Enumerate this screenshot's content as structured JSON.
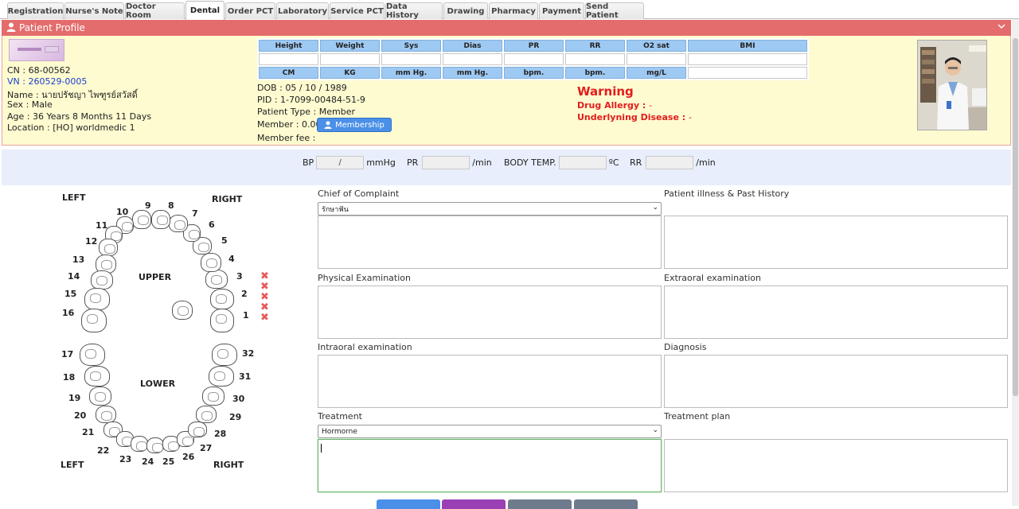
{
  "tabs": [
    {
      "label": "Registration",
      "active": false
    },
    {
      "label": "Nurse's Note",
      "active": false
    },
    {
      "label": "Doctor Room",
      "active": false
    },
    {
      "label": "Dental",
      "active": true
    },
    {
      "label": "Order PCT",
      "active": false
    },
    {
      "label": "Laboratory",
      "active": false
    },
    {
      "label": "Service PCT",
      "active": false
    },
    {
      "label": "Data History",
      "active": false
    },
    {
      "label": "Drawing",
      "active": false
    },
    {
      "label": "Pharmacy",
      "active": false
    },
    {
      "label": "Payment",
      "active": false
    },
    {
      "label": "Send Patient",
      "active": false
    }
  ],
  "profile": {
    "title": "Patient Profile",
    "cn": "CN : 68-00562",
    "vn": "VN : 260529-0005",
    "name": "Name : นายปรัชญา ไพฑูรย์สวัสดิ์",
    "sex": "Sex : Male",
    "age": "Age : 36 Years 8 Months 11 Days",
    "location": "Location : [HO] worldmedic 1",
    "dob": "DOB : 05 / 10 / 1989",
    "pid": "PID : 1-7099-00484-51-9",
    "patient_type": "Patient Type : Member",
    "member": "Member : 0.00",
    "membership_button": "Membership",
    "member_fee": "Member fee :"
  },
  "vitals_table": {
    "headers": [
      "Height",
      "Weight",
      "Sys",
      "Dias",
      "PR",
      "RR",
      "O2 sat",
      "BMI"
    ],
    "units": [
      "CM",
      "KG",
      "mm Hg.",
      "mm Hg.",
      "bpm.",
      "bpm.",
      "mg/L",
      ""
    ]
  },
  "warning": {
    "title": "Warning",
    "allergy_label": "Drug Allergy :",
    "allergy_value": "-",
    "disease_label": "Underlyning Disease :",
    "disease_value": "-"
  },
  "vital_signs": {
    "bp_label": "BP",
    "bp_sep": "/",
    "bp_unit": "mmHg",
    "pr_label": "PR",
    "pr_unit": "/min",
    "temp_label": "BODY TEMP.",
    "temp_unit": "ºC",
    "rr_label": "RR",
    "rr_unit": "/min"
  },
  "dental_chart": {
    "left_top": "LEFT",
    "right_top": "RIGHT",
    "upper": "UPPER",
    "lower": "LOWER",
    "left_bottom": "LEFT",
    "right_bottom": "RIGHT",
    "teeth": [
      "1",
      "2",
      "3",
      "4",
      "5",
      "6",
      "7",
      "8",
      "9",
      "10",
      "11",
      "12",
      "13",
      "14",
      "15",
      "16",
      "17",
      "18",
      "19",
      "20",
      "21",
      "22",
      "23",
      "24",
      "25",
      "26",
      "27",
      "28",
      "29",
      "30",
      "31",
      "32"
    ]
  },
  "form": {
    "chief_complaint_label": "Chief of Complaint",
    "chief_complaint_selected": "รักษาฟัน",
    "illness_label": "Patient illness & Past History",
    "physical_label": "Physical Examination",
    "extraoral_label": "Extraoral examination",
    "intraoral_label": "Intraoral examination",
    "diagnosis_label": "Diagnosis",
    "treatment_label": "Treatment",
    "treatment_selected": "Hormorne",
    "treatment_plan_label": "Treatment plan"
  },
  "colors": {
    "header_bar": "#e46c6c",
    "profile_bg": "#fefbd0",
    "vital_header": "#9ec9f3",
    "warning": "#e31c1c",
    "vital_row_bg": "#e8eefb",
    "btn_blue": "#4a8fe8",
    "btn_purple": "#9b3fb5",
    "btn_gray": "#6e7b8c"
  }
}
